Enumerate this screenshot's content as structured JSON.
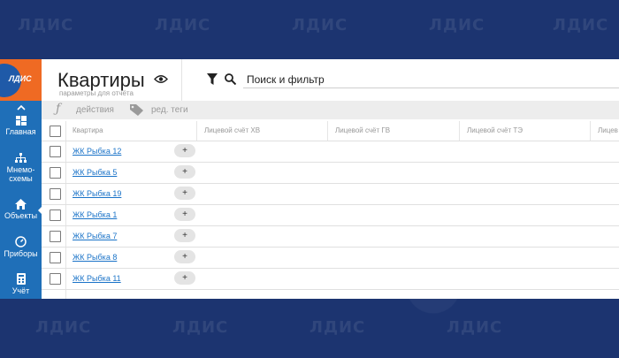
{
  "brand": {
    "logo_text": "ЛДИС",
    "watermark": "ЛДИС"
  },
  "sidebar": {
    "items": [
      {
        "label": "Главная",
        "icon": "dashboard-icon"
      },
      {
        "label": "Мнемо-схемы",
        "icon": "hierarchy-icon"
      },
      {
        "label": "Объекты",
        "icon": "home-icon",
        "active": true
      },
      {
        "label": "Приборы",
        "icon": "gauge-icon"
      },
      {
        "label": "Учёт",
        "icon": "calculator-icon"
      }
    ]
  },
  "header": {
    "title": "Квартиры",
    "subtitle": "параметры для отчёта",
    "search_value": "Поиск и фильтр"
  },
  "toolbar": {
    "actions_label": "действия",
    "tags_label": "ред. теги"
  },
  "table": {
    "columns": [
      "Квартира",
      "Лицевой счёт ХВ",
      "Лицевой счёт ГВ",
      "Лицевой счёт ТЭ",
      "Лицев"
    ],
    "rows": [
      {
        "name": "ЖК Рыбка 12"
      },
      {
        "name": "ЖК Рыбка 5"
      },
      {
        "name": "ЖК Рыбка 19"
      },
      {
        "name": "ЖК Рыбка 1"
      },
      {
        "name": "ЖК Рыбка 7"
      },
      {
        "name": "ЖК Рыбка 8"
      },
      {
        "name": "ЖК Рыбка 11"
      }
    ],
    "add_label": "+"
  },
  "colors": {
    "sidebar": "#1f6fb8",
    "logo": "#ef6a23",
    "background": "#1c3470",
    "link": "#1a73c8"
  }
}
